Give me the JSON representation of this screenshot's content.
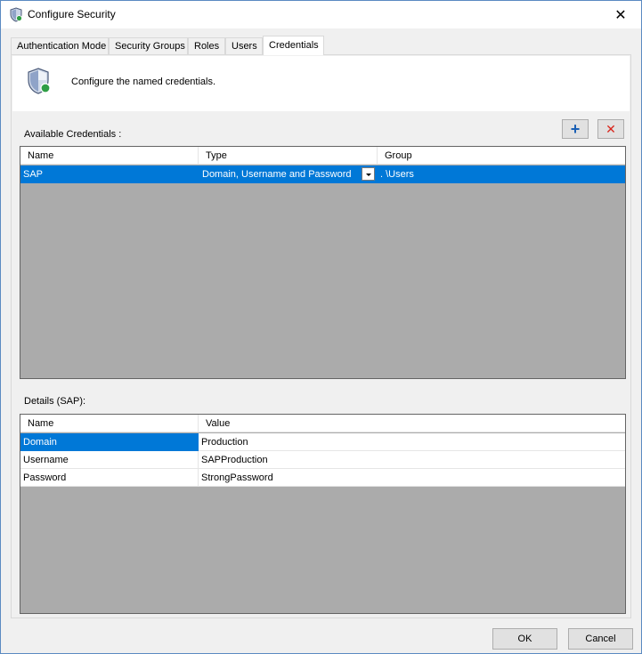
{
  "window": {
    "title": "Configure Security",
    "close_glyph": "✕"
  },
  "tabs": [
    {
      "label": "Authentication Mode"
    },
    {
      "label": "Security Groups"
    },
    {
      "label": "Roles"
    },
    {
      "label": "Users"
    },
    {
      "label": "Credentials",
      "active": true
    }
  ],
  "header": {
    "text": "Configure the named credentials."
  },
  "credentials": {
    "label": "Available Credentials :",
    "add_glyph": "+",
    "remove_glyph": "✕",
    "columns": [
      "Name",
      "Type",
      "Group"
    ],
    "rows": [
      {
        "name": "SAP",
        "type": "Domain, Username and Password",
        "group": ". \\Users"
      }
    ]
  },
  "details": {
    "label": "Details (SAP):",
    "columns": [
      "Name",
      "Value"
    ],
    "rows": [
      {
        "name": "Domain",
        "value": "Production"
      },
      {
        "name": "Username",
        "value": "SAPProduction"
      },
      {
        "name": "Password",
        "value": "StrongPassword"
      }
    ]
  },
  "footer": {
    "ok_label": "OK",
    "cancel_label": "Cancel"
  },
  "colors": {
    "selection": "#0078d7",
    "grid_empty": "#ababab",
    "add_icon": "#1a5fb4",
    "remove_icon": "#d9261c"
  },
  "icons": {
    "title": "shield-icon",
    "header": "shield-check-icon"
  }
}
